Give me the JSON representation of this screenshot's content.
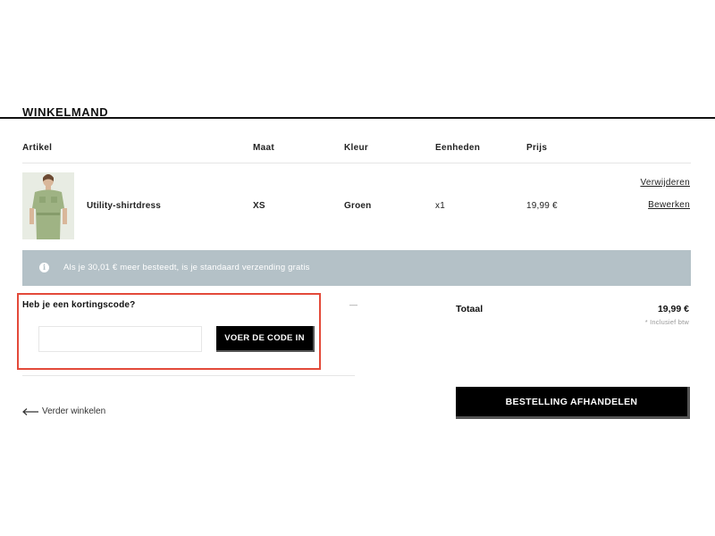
{
  "page": {
    "title": "WINKELMAND"
  },
  "table": {
    "headers": [
      "Artikel",
      "Maat",
      "Kleur",
      "Eenheden",
      "Prijs"
    ]
  },
  "item": {
    "name": "Utility-shirtdress",
    "size": "XS",
    "color": "Groen",
    "units": "x1",
    "price": "19,99 €",
    "remove_label": "Verwijderen",
    "edit_label": "Bewerken",
    "image_alt": "product-photo"
  },
  "banner": {
    "icon": "info-icon",
    "text": "Als je 30,01 € meer besteedt, is je standaard verzending gratis"
  },
  "coupon": {
    "question": "Heb je een kortingscode?",
    "input_value": "",
    "button_label": "VOER DE CODE IN",
    "dash": "—"
  },
  "summary": {
    "total_label": "Totaal",
    "total_value": "19,99 €",
    "vat_note": "* Inclusief btw",
    "checkout_label": "BESTELLING AFHANDELEN"
  },
  "nav": {
    "continue_label": "Verder winkelen"
  },
  "colors": {
    "banner_bg": "#b4c1c7",
    "highlight": "#e34a3a",
    "button_bg": "#000000"
  }
}
